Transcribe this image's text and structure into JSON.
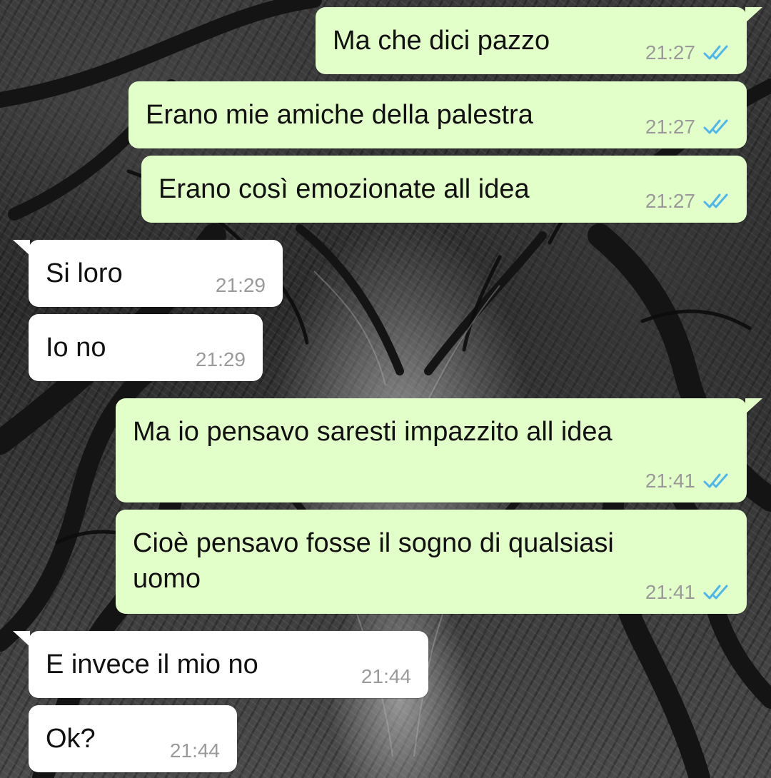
{
  "messages": [
    {
      "text": "Ma che dici pazzo",
      "time": "21:27",
      "status": "read-double-check-icon"
    },
    {
      "text": "Erano mie amiche della palestra",
      "time": "21:27",
      "status": "read-double-check-icon"
    },
    {
      "text": "Erano così emozionate all idea",
      "time": "21:27",
      "status": "read-double-check-icon"
    },
    {
      "text": "Si loro",
      "time": "21:29"
    },
    {
      "text": "Io no",
      "time": "21:29"
    },
    {
      "text": "Ma io pensavo saresti impazzito all idea",
      "time": "21:41",
      "status": "read-double-check-icon"
    },
    {
      "text": "Cioè pensavo fosse il sogno di qualsiasi\nuomo",
      "time": "21:41",
      "status": "read-double-check-icon"
    },
    {
      "text": "E invece il mio no",
      "time": "21:44"
    },
    {
      "text": "Ok?",
      "time": "21:44"
    }
  ],
  "colors": {
    "outgoing_bubble": "#e2ffc9",
    "incoming_bubble": "#ffffff",
    "read_ticks": "#4fb6ec",
    "timestamp": "#9a9a9a"
  }
}
